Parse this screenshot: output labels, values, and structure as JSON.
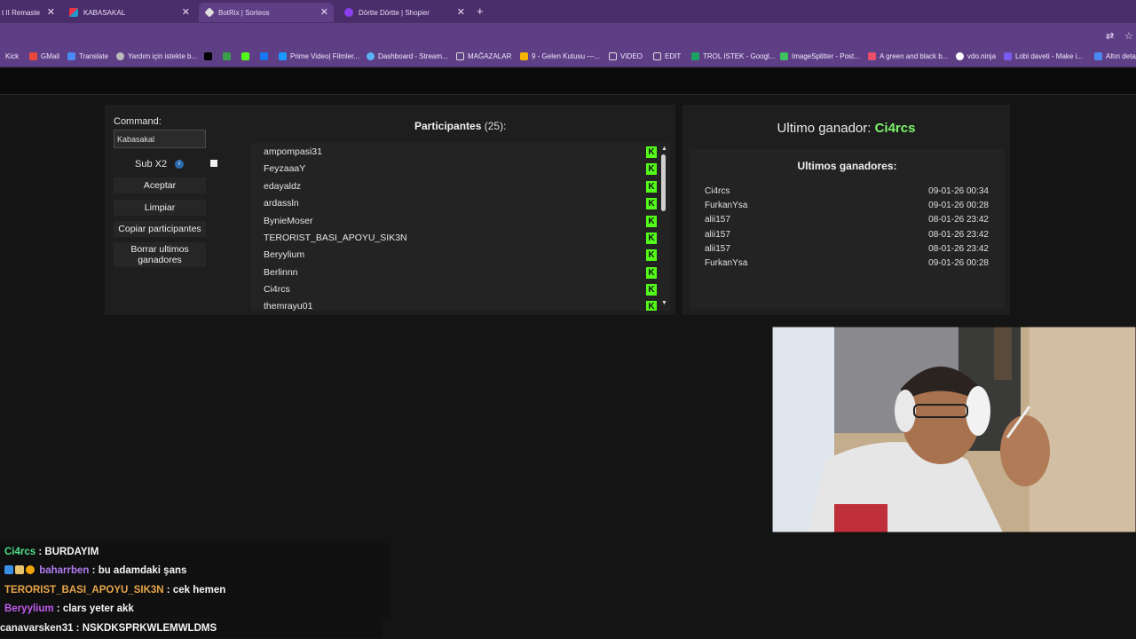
{
  "browser": {
    "tabs": [
      {
        "label": "t II Remaste"
      },
      {
        "label": "KABASAKAL"
      },
      {
        "label": "BotRix | Sorteos"
      },
      {
        "label": "Dörtte Dörtte | Shopier"
      }
    ],
    "bookmarks": [
      {
        "label": "Kick"
      },
      {
        "label": "GMail"
      },
      {
        "label": "Translate"
      },
      {
        "label": "Yardım için istekte b..."
      },
      {
        "label": "Prime Video| Filmler..."
      },
      {
        "label": "Dashboard - Stream..."
      },
      {
        "label": "MAĞAZALAR"
      },
      {
        "label": "9 - Gelen Kutusu —..."
      },
      {
        "label": "VIDEO"
      },
      {
        "label": "EDIT"
      },
      {
        "label": "TROL ISTEK - Googl..."
      },
      {
        "label": "ImageSplitter - Post..."
      },
      {
        "label": "A green and black b..."
      },
      {
        "label": "vdo.ninja"
      },
      {
        "label": "Lobi daveti - Make i..."
      },
      {
        "label": "Altın deta"
      }
    ]
  },
  "raffle": {
    "command_label": "Command:",
    "command_value": "Kabasakal",
    "sub_label": "Sub X2",
    "buttons": {
      "accept": "Aceptar",
      "clear": "Limpiar",
      "copy": "Copiar participantes",
      "delete_line1": "Borrar ultimos",
      "delete_line2": "ganadores"
    },
    "participants_title": "Participantes",
    "participants_count": "(25):",
    "participants": [
      "ampompasi31",
      "FeyzaaaY",
      "edayaldz",
      "ardassln",
      "BynieMoser",
      "TERORIST_BASI_APOYU_SIK3N",
      "Beryylium",
      "Berlinnn",
      "Ci4rcs",
      "themrayu01"
    ]
  },
  "winners": {
    "last_winner_label": "Ultimo ganador:",
    "last_winner_name": "Ci4rcs",
    "list_title": "Ultimos ganadores:",
    "rows": [
      {
        "name": "Ci4rcs",
        "date": "09-01-26 00:34"
      },
      {
        "name": "FurkanYsa",
        "date": "09-01-26 00:28"
      },
      {
        "name": "alii157",
        "date": "08-01-26 23:42"
      },
      {
        "name": "alii157",
        "date": "08-01-26 23:42"
      },
      {
        "name": "alii157",
        "date": "08-01-26 23:42"
      },
      {
        "name": "FurkanYsa",
        "date": "09-01-26 00:28"
      }
    ]
  },
  "chat": [
    {
      "user": "Ci4rcs",
      "sep": " : ",
      "text": "BURDAYIM",
      "color": "#4ee08a"
    },
    {
      "user": "baharrben",
      "sep": " : ",
      "text": "bu adamdaki şans",
      "color": "#b07cf0"
    },
    {
      "user": "TERORIST_BASI_APOYU_SIK3N",
      "sep": " : ",
      "text": "cek hemen",
      "color": "#e8a64a"
    },
    {
      "user": "Beryylium",
      "sep": " : ",
      "text": "clars yeter akk",
      "color": "#c35cf0"
    },
    {
      "user": "canavarsken31",
      "sep": " : ",
      "text": "NSKDKSPRKWLEMWLDMS",
      "color": "#f0f0f0"
    }
  ]
}
